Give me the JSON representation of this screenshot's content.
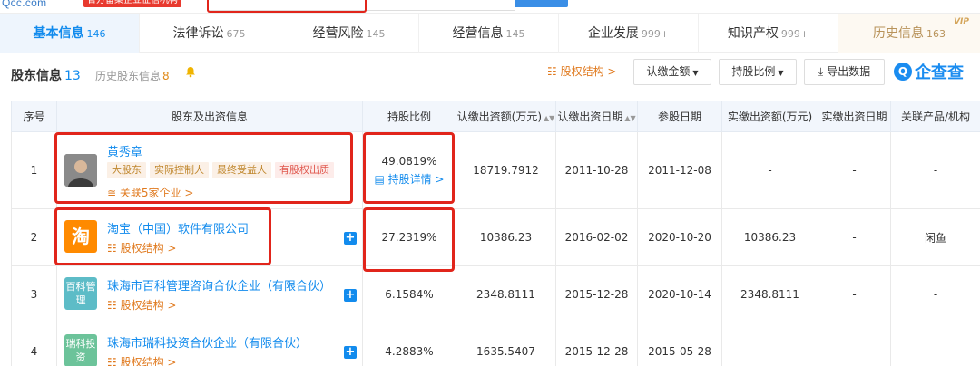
{
  "header": {
    "logo_text": "Qcc.com",
    "logo_badge": "官方备案企业征信机构"
  },
  "tabs": [
    {
      "label": "基本信息",
      "count": "146"
    },
    {
      "label": "法律诉讼",
      "count": "675"
    },
    {
      "label": "经营风险",
      "count": "145"
    },
    {
      "label": "经营信息",
      "count": "145"
    },
    {
      "label": "企业发展",
      "count": "999+"
    },
    {
      "label": "知识产权",
      "count": "999+"
    },
    {
      "label": "历史信息",
      "count": "163",
      "badge": "VIP"
    }
  ],
  "section": {
    "title": "股东信息",
    "count": "13",
    "history_label": "历史股东信息",
    "history_count": "8",
    "equity_structure_link": "股权结构 >",
    "dropdowns": [
      "认缴金额",
      "持股比例"
    ],
    "export_label": "导出数据",
    "brand_text": "企查查"
  },
  "table": {
    "headers": [
      "序号",
      "股东及出资信息",
      "持股比例",
      "认缴出资额(万元)",
      "认缴出资日期",
      "参股日期",
      "实缴出资额(万元)",
      "实缴出资日期",
      "关联产品/机构"
    ],
    "rows": [
      {
        "index": "1",
        "name": "黄秀章",
        "avatar": "person",
        "tags": [
          "大股东",
          "实际控制人",
          "最终受益人",
          "有股权出质"
        ],
        "link": "关联5家企业 >",
        "ratio": "49.0819%",
        "ratio_detail": "持股详情 >",
        "subscribed_amount": "18719.7912",
        "subscribed_date": "2011-10-28",
        "join_date": "2011-12-08",
        "paid_amount": "-",
        "paid_date": "-",
        "product": "-"
      },
      {
        "index": "2",
        "name": "淘宝（中国）软件有限公司",
        "avatar_text": "淘",
        "link": "股权结构 >",
        "ratio": "27.2319%",
        "subscribed_amount": "10386.23",
        "subscribed_date": "2016-02-02",
        "join_date": "2020-10-20",
        "paid_amount": "10386.23",
        "paid_date": "-",
        "product": "闲鱼"
      },
      {
        "index": "3",
        "name": "珠海市百科管理咨询合伙企业（有限合伙）",
        "avatar_text": "百科管理",
        "link": "股权结构 >",
        "ratio": "6.1584%",
        "subscribed_amount": "2348.8111",
        "subscribed_date": "2015-12-28",
        "join_date": "2020-10-14",
        "paid_amount": "2348.8111",
        "paid_date": "-",
        "product": "-"
      },
      {
        "index": "4",
        "name": "珠海市瑞科投资合伙企业（有限合伙）",
        "avatar_text": "瑞科投资",
        "link": "股权结构 >",
        "ratio": "4.2883%",
        "subscribed_amount": "1635.5407",
        "subscribed_date": "2015-12-28",
        "join_date": "2015-05-28",
        "paid_amount": "-",
        "paid_date": "-",
        "product": "-"
      }
    ]
  },
  "colors": {
    "accent": "#128bed",
    "highlight_box": "#e1251b",
    "link_orange": "#e07a1f"
  }
}
